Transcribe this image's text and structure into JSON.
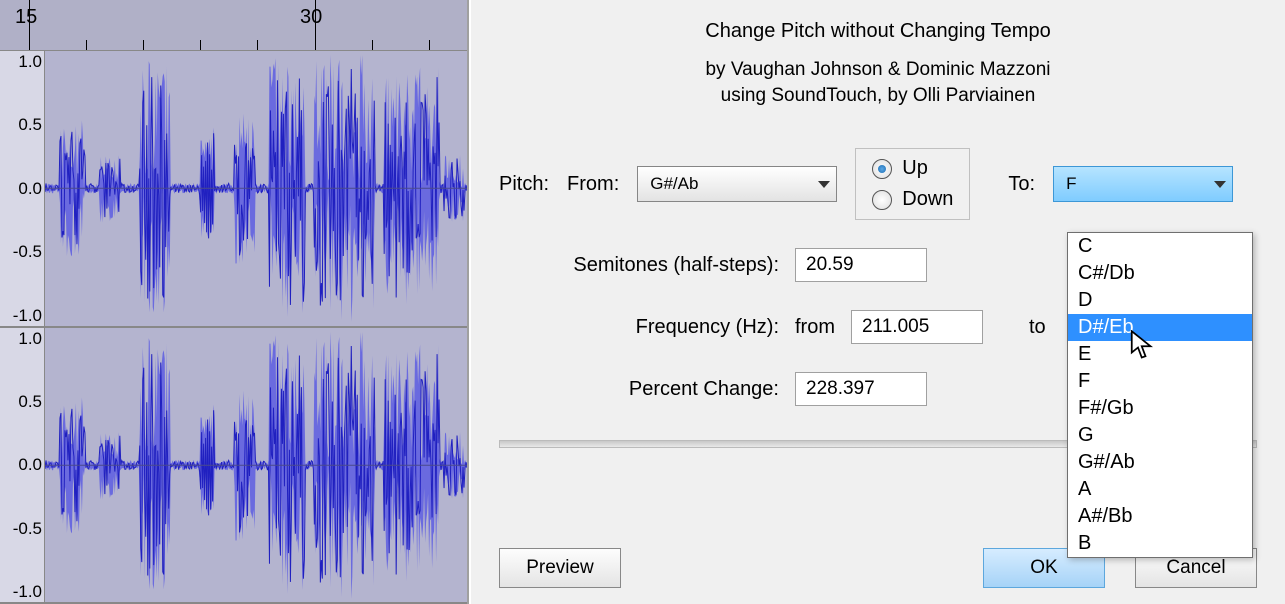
{
  "ruler": {
    "ticks": [
      "15",
      "30"
    ]
  },
  "yaxis": {
    "vals": [
      "1.0",
      "0.5",
      "0.0",
      "-0.5",
      "-1.0"
    ]
  },
  "dialog": {
    "title": "Change Pitch without Changing Tempo",
    "credits1": "by Vaughan Johnson & Dominic Mazzoni",
    "credits2": "using SoundTouch, by Olli Parviainen",
    "pitchLabel": "Pitch:",
    "fromLabel": "From:",
    "fromNote": "G#/Ab",
    "radioUp": "Up",
    "radioDown": "Down",
    "radioSelected": "up",
    "toLabel": "To:",
    "toNote": "F",
    "semiLabel": "Semitones (half-steps):",
    "semiVal": "20.59",
    "freqLabel": "Frequency (Hz):",
    "freqFromLabel": "from",
    "freqFromVal": "211.005",
    "freqToLabel": "to",
    "pctLabel": "Percent Change:",
    "pctVal": "228.397",
    "previewBtn": "Preview",
    "okBtn": "OK",
    "cancelBtn": "Cancel"
  },
  "dropdown": {
    "highlight": 3,
    "options": [
      "C",
      "C#/Db",
      "D",
      "D#/Eb",
      "E",
      "F",
      "F#/Gb",
      "G",
      "G#/Ab",
      "A",
      "A#/Bb",
      "B"
    ]
  }
}
